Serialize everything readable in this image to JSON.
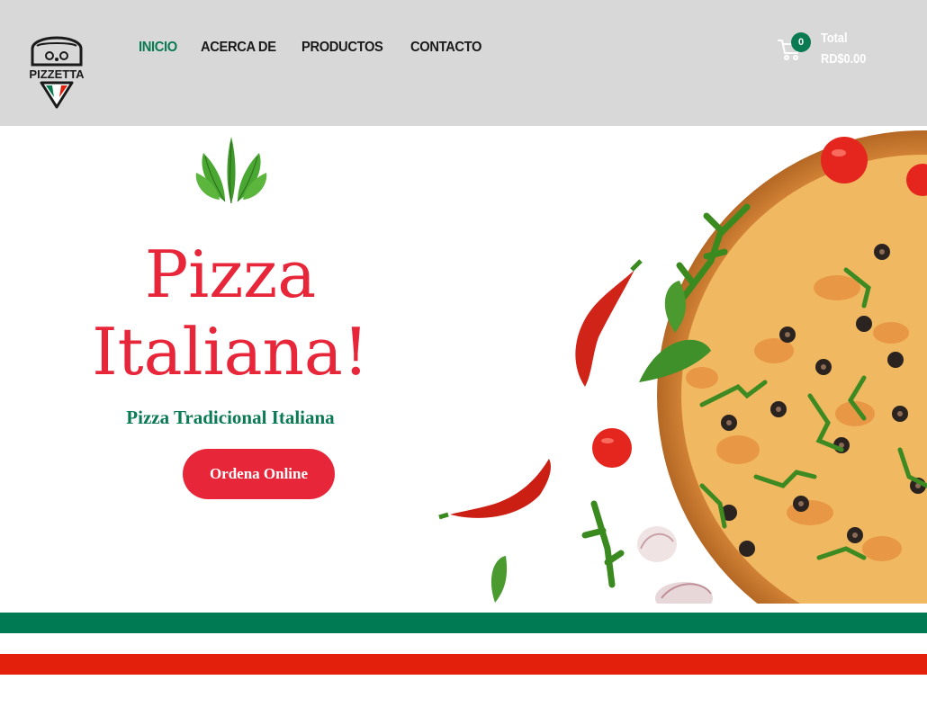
{
  "brand": {
    "logo_text": "PIZZETTA"
  },
  "nav": {
    "items": [
      {
        "label": "INICIO",
        "active": true
      },
      {
        "label": "ACERCA DE",
        "active": false
      },
      {
        "label": "PRODUCTOS",
        "active": false
      },
      {
        "label": "CONTACTO",
        "active": false
      }
    ]
  },
  "cart": {
    "count": "0",
    "total_label": "Total",
    "total_value": "RD$0.00",
    "icon": "cart-icon"
  },
  "hero": {
    "title_line1": "Pizza",
    "title_line2": "Italiana!",
    "subtitle": "Pizza Tradicional Italiana",
    "cta_label": "Ordena Online"
  },
  "colors": {
    "accent_green": "#0a7a52",
    "accent_red": "#e8263a",
    "header_bg": "#d8d8d8",
    "flag_green": "#007a53",
    "flag_red": "#e2200c"
  }
}
